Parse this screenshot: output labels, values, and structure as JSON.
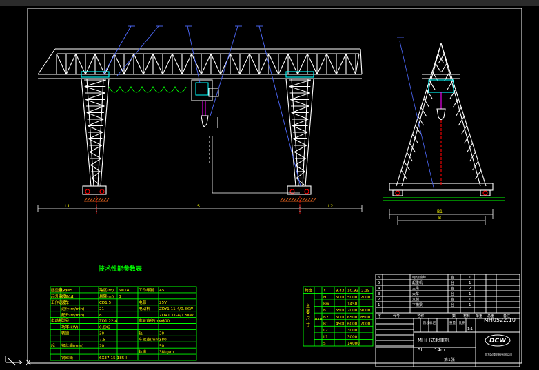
{
  "colors": {
    "background": "#000000",
    "white_lines": "#ffffff",
    "green_tables": "#00ff00",
    "yellow_text": "#ffff00",
    "cyan": "#00ffff",
    "red": "#ff0000",
    "magenta": "#ff00ff",
    "blue_leader": "#4f6bff",
    "orange_hatch": "#c8561a"
  },
  "views": {
    "front_dims": {
      "left": "L1",
      "span": "S",
      "right": "L2"
    },
    "side_dims": {
      "overall": "B1",
      "gauge": "B"
    }
  },
  "spec_table": {
    "title": "技术性能参数表",
    "rows": [
      {
        "c1": "起重量(t)",
        "c2": "Gn=5",
        "c3": "跨度(m)",
        "c4": "S=14",
        "c5": "工作级别",
        "c6": "A5"
      },
      {
        "c1": "起升高度(m)",
        "c2": "6.9.12",
        "c3": "悬臂(m)",
        "c4": "3",
        "c5": "",
        "c6": ""
      },
      {
        "c1": "工作速度",
        "c2": "大车",
        "c3": "CD1.5",
        "c4": "",
        "c5": "电源",
        "c6": "25V"
      },
      {
        "c1": "",
        "c2": "运行(m/min)",
        "c3": "21",
        "c4": "",
        "c5": "电动机",
        "c6": "ZDY1 11-4/0.8KW"
      },
      {
        "c1": "",
        "c2": "起升(m/min)",
        "c3": "8",
        "c4": "",
        "c5": "",
        "c6": "ZDR1 11-4/1.5KW"
      },
      {
        "c1": "电动机",
        "c2": "型号",
        "c3": "ZD1 22-4",
        "c4": "",
        "c5": "车轮直径(mm)",
        "c6": "Φ300"
      },
      {
        "c1": "",
        "c2": "功率(kW)",
        "c3": "0.8X2",
        "c4": "",
        "c5": "",
        "c6": ""
      },
      {
        "c1": "",
        "c2": "转速",
        "c3": "20",
        "c4": "",
        "c5": "轨",
        "c6": "30"
      },
      {
        "c1": "",
        "c2": "",
        "c3": "7.5",
        "c4": "",
        "c5": "车轮宽(mm)",
        "c6": "380"
      },
      {
        "c1": "起",
        "c2": "钢丝绳(mm)",
        "c3": "20",
        "c4": "",
        "c5": "",
        "c6": "50"
      },
      {
        "c1": "",
        "c2": "",
        "c3": "",
        "c4": "",
        "c5": "轨道",
        "c6": "38kg/m"
      },
      {
        "c1": "",
        "c2": "钢丝绳",
        "c3": "6X37-15-185-I",
        "c4": "",
        "c5": "",
        "c6": ""
      }
    ]
  },
  "dim_table": {
    "header": [
      "跨度",
      "t",
      "9.43",
      "10.93",
      "2.15"
    ],
    "side_label": "主要尺寸",
    "unit": "mm",
    "rows": [
      {
        "k": "H",
        "v": [
          "5000",
          "5000",
          "2000"
        ]
      },
      {
        "k": "Bw",
        "v": [
          "",
          "1450",
          ""
        ]
      },
      {
        "k": "B",
        "v": [
          "5500",
          "7000",
          "9000"
        ]
      },
      {
        "k": "B2",
        "v": [
          "5000",
          "6500",
          "8500"
        ]
      },
      {
        "k": "B1",
        "v": [
          "4500",
          "6000",
          "7000"
        ]
      },
      {
        "k": "L2",
        "v": [
          "",
          "3000",
          ""
        ]
      },
      {
        "k": "L1",
        "v": [
          "",
          "3000",
          ""
        ]
      },
      {
        "k": "S",
        "v": [
          "",
          "14000",
          ""
        ]
      }
    ]
  },
  "title_block": {
    "parts": [
      {
        "no": "6",
        "name": "电动葫芦",
        "qty": "1"
      },
      {
        "no": "5",
        "name": "起重机",
        "qty": "1"
      },
      {
        "no": "4",
        "name": "主梁",
        "qty": "2"
      },
      {
        "no": "3",
        "name": "大车",
        "qty": "1"
      },
      {
        "no": "2",
        "name": "支腿",
        "qty": "1"
      },
      {
        "no": "1",
        "name": "下横梁",
        "qty": "1"
      }
    ],
    "headers": [
      "序",
      "代号",
      "名称",
      "数",
      "材料",
      "单重",
      "总重",
      "备注"
    ],
    "drawing_no": "MH0522.10",
    "stamp": "阶段标记",
    "weight": "重量",
    "scale": "比例",
    "scale_value": "1:1",
    "product_name": "MH门式起重机",
    "capacity": "5t",
    "span": "14m",
    "company_logo": "DCW",
    "company_name": "大方起重机械有限公司",
    "sheet": "第1张"
  }
}
